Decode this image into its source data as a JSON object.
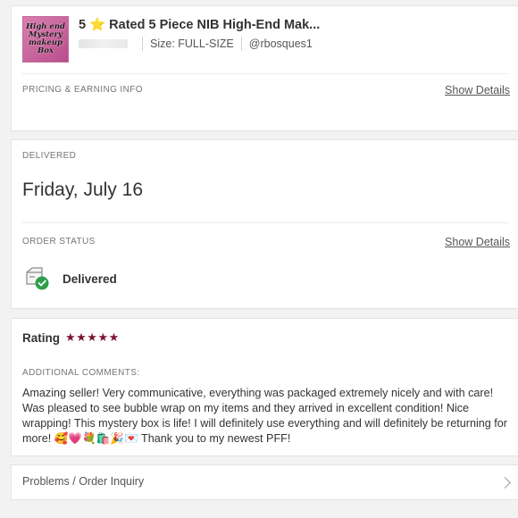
{
  "product": {
    "title": "5 ⭐️ Rated 5 Piece NIB High-End Mak...",
    "size": "Size: FULL-SIZE",
    "seller": "@rbosques1",
    "thumbnail_text": "High end Mystery makeup Box"
  },
  "pricing": {
    "label": "PRICING & EARNING INFO",
    "show_details": "Show Details"
  },
  "delivery": {
    "label": "DELIVERED",
    "date": "Friday, July 16"
  },
  "order_status": {
    "label": "ORDER STATUS",
    "show_details": "Show Details",
    "status": "Delivered",
    "icon": "delivered-box-icon",
    "check_color": "#2e9e4a"
  },
  "rating": {
    "label": "Rating",
    "stars": 5,
    "star_glyphs": "★★★★★",
    "star_color": "#7b1530",
    "comments_label": "ADDITIONAL COMMENTS:",
    "comment": "Amazing seller! Very communicative, everything was packaged extremely nicely and with care! Was pleased to see bubble wrap on my items and they arrived in excellent condition! Nice wrapping! This mystery box is life! I will definitely use everything and will definitely be returning for more! 🥰💗💐🛍️🎉💌 Thank you to my newest PFF!"
  },
  "problems": {
    "label": "Problems / Order Inquiry"
  }
}
